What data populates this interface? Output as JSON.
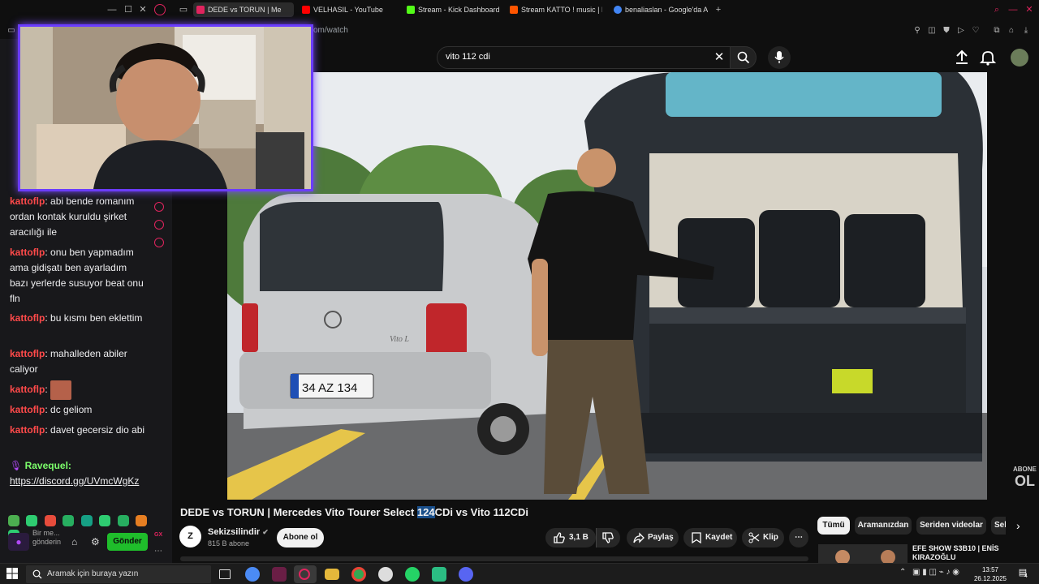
{
  "browser": {
    "tabs": [
      {
        "label": "DEDE vs TORUN | Me",
        "active": true,
        "color": "#e0245e"
      },
      {
        "label": "VELHASIL - YouTube",
        "active": false,
        "color": "#ff0000"
      },
      {
        "label": "Stream - Kick Dashboard",
        "active": false,
        "color": "#53fc18"
      },
      {
        "label": "Stream KATTO ! music | L",
        "active": false,
        "color": "#ff5500"
      },
      {
        "label": "benaliaslan - Google'da A",
        "active": false,
        "color": "#4285f4"
      }
    ],
    "url_fragment": "om/watch"
  },
  "youtube": {
    "search_value": "vito 112 cdi",
    "video_title_before": "DEDE vs TORUN | Mercedes Vito Tourer Select ",
    "video_title_highlight": "124",
    "video_title_after": "CDi vs Vito 112CDi",
    "channel_avatar_text": "Z",
    "channel_name": "Sekizsilindir",
    "subscribers": "815 B abone",
    "subscribe_label": "Abone ol",
    "likes": "3,1 B",
    "share_label": "Paylaş",
    "save_label": "Kaydet",
    "clip_label": "Klip",
    "chips": [
      "Tümü",
      "Aramanızdan",
      "Seriden videolar",
      "Sel"
    ],
    "rec_title": "EFE SHOW S3B10 | ENİS KIRAZOĞLU",
    "watermark": [
      "ABONE",
      "OL"
    ],
    "plate": "34 AZ 134",
    "badge": "Vito L"
  },
  "chat": {
    "messages": [
      {
        "user": "kattoflp",
        "text": "abi bende romanım ordan kontak kuruldu şirket aracılığı ile"
      },
      {
        "user": "kattoflp",
        "text": "onu ben yapmadım ama gidişatı ben ayarladım bazı yerlerde susuyor beat onu fln"
      },
      {
        "user": "kattoflp",
        "text": "bu kısmı ben eklettim"
      },
      {
        "user": "kattoflp",
        "text": "mahalleden abiler caliyor"
      },
      {
        "user": "kattoflp",
        "text": ""
      },
      {
        "user": "kattoflp",
        "text": "dc geliom"
      },
      {
        "user": "kattoflp",
        "text": "davet gecersiz dio abi"
      }
    ],
    "last_user": "Ravequel:",
    "last_link": "https://discord.gg/UVmcWgKz",
    "input_hint": "Bir me... gönderin",
    "send_label": "Gönder",
    "gift_label": "GX",
    "emote_colors": [
      "#4caf50",
      "#2ecc71",
      "#e74c3c",
      "#27ae60",
      "#16a085",
      "#2ecc71",
      "#27ae60",
      "#e67e22",
      "#2ecc71"
    ]
  },
  "taskbar": {
    "search_placeholder": "Aramak için buraya yazın",
    "time": "13:57",
    "date": "26.12.2025",
    "notification_count": "4"
  }
}
